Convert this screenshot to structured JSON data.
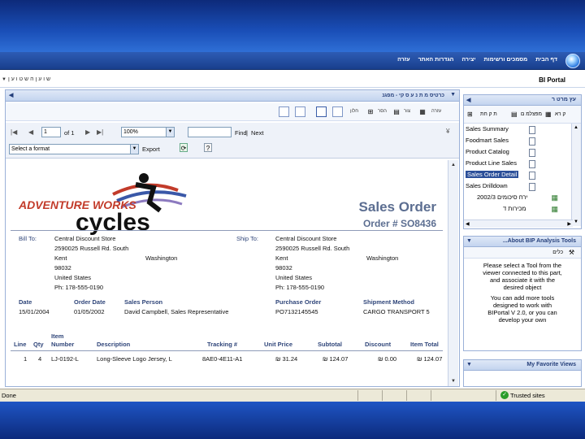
{
  "nav": {
    "items": [
      "דף הבית",
      "מסמכים ורשימות",
      "יצירה",
      "הגדרות האתר",
      "עזרה"
    ]
  },
  "title": {
    "portal": "BI Portal",
    "search_link": "ש ו ע ן ה ש ט ו ע ן"
  },
  "webpart": {
    "title": "כרטיס מ ת נ ע ס קי - מפגנ",
    "toolbar_labels": [
      "עזרה",
      "צור",
      "הסר",
      "חלון"
    ],
    "page_value": "1",
    "of_label": "of 1",
    "zoom": "100%",
    "find_label": "Find",
    "next_label": "Next",
    "format_placeholder": "Select a format",
    "export_label": "Export"
  },
  "report": {
    "logo_text1": "ADVENTURE WORKS",
    "logo_text2": "cycles",
    "title": "Sales Order",
    "order_no": "Order # SO8436",
    "bill_to_label": "Bill To:",
    "ship_to_label": "Ship To:",
    "bill": [
      "Central Discount Store",
      "2590025 Russell Rd. South",
      "Kent",
      "98032",
      "United States",
      "Ph: 178-555-0190"
    ],
    "bill_state": "Washington",
    "ship": [
      "Central Discount Store",
      "2590025 Russell Rd. South",
      "Kent",
      "98032",
      "United States",
      "Ph: 178-555-0190"
    ],
    "ship_state": "Washington",
    "info_headers": [
      "Date",
      "Order Date",
      "Sales Person",
      "Purchase Order",
      "Shipment Method"
    ],
    "info_values": [
      "15/01/2004",
      "01/05/2002",
      "David Campbell, Sales Representative",
      "PO7132145545",
      "CARGO TRANSPORT 5"
    ],
    "line_headers": [
      "Line",
      "Qty",
      "Item Number",
      "Description",
      "Tracking #",
      "Unit Price",
      "Subtotal",
      "Discount",
      "Item Total"
    ],
    "line_item": [
      "1",
      "4",
      "LJ-0192-L",
      "Long-Sleeve Logo Jersey, L",
      "8AE0-4E11-A1",
      "₪ 31.24",
      "₪ 124.07",
      "₪ 0.00",
      "₪ 124.07"
    ]
  },
  "side1": {
    "title": "עץ מרט ר",
    "toolbar": [
      "ק רא",
      "מפצלמ ם",
      "ת ק חת"
    ],
    "items": [
      "Sales Summary",
      "Foodmart Sales",
      "Product Catalog",
      "Product Line Sales",
      "Sales Order Detail",
      "Sales Drilldown",
      "2002/3 ירח סיכומים",
      "מכירות ד"
    ]
  },
  "side2": {
    "title": "...About BIP Analysis Tools",
    "sub": "כלים",
    "text": [
      "Please select a Tool from the",
      "viewer connected to this part,",
      "and associate it with the",
      "desired object",
      "",
      "You can add more tools",
      "designed to work with",
      "BIPortal V 2.0, or you can",
      "develop your own"
    ]
  },
  "side3": {
    "title": "My Favorite Views"
  },
  "status": {
    "done": "Done",
    "trusted": "Trusted sites"
  },
  "colors": {
    "brand_blue": "#1a4fb8",
    "report_title": "#5c6e91",
    "label_blue": "#30467a"
  }
}
